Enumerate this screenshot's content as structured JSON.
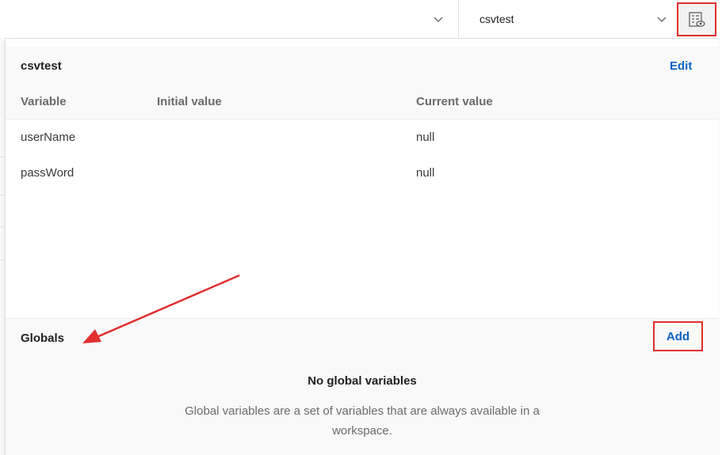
{
  "topbar": {
    "left_selector_value": "",
    "environment_selector": {
      "selected": "csvtest",
      "icon": "chevron-down-icon"
    },
    "quick_look_button": {
      "icon": "environment-quick-look-icon"
    }
  },
  "environment": {
    "name": "csvtest",
    "edit_label": "Edit",
    "columns": [
      "Variable",
      "Initial value",
      "Current value"
    ],
    "variables": [
      {
        "variable": "userName",
        "initial": "",
        "current": "null"
      },
      {
        "variable": "passWord",
        "initial": "",
        "current": "null"
      }
    ]
  },
  "globals": {
    "title": "Globals",
    "add_label": "Add",
    "empty_title": "No global variables",
    "empty_description": "Global variables are a set of variables that are always available in a workspace."
  },
  "colors": {
    "link_blue": "#0b62c4",
    "annotation_red": "#e02f2f"
  }
}
